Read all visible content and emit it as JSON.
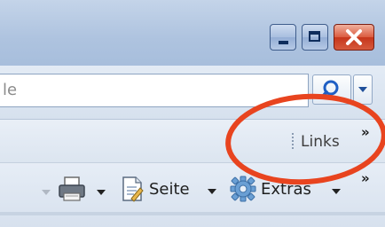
{
  "window": {
    "buttons": {
      "minimize": "minimize-icon",
      "maximize": "maximize-icon",
      "close": "close-icon"
    },
    "colors": {
      "titlebar": "#aec3df",
      "close": "#db5b3f",
      "annotation": "#e8441f"
    }
  },
  "search": {
    "visible_text": "le",
    "button_icon": "search-icon",
    "dropdown_icon": "chevron-down-icon"
  },
  "links_bar": {
    "label": "Links",
    "overflow": "»"
  },
  "command_bar": {
    "page_label": "Seite",
    "tools_label": "Extras",
    "overflow": "»",
    "icons": [
      "printer-icon",
      "page-icon",
      "gear-icon"
    ]
  },
  "annotation": {
    "shape": "ellipse",
    "target": "links-label"
  }
}
